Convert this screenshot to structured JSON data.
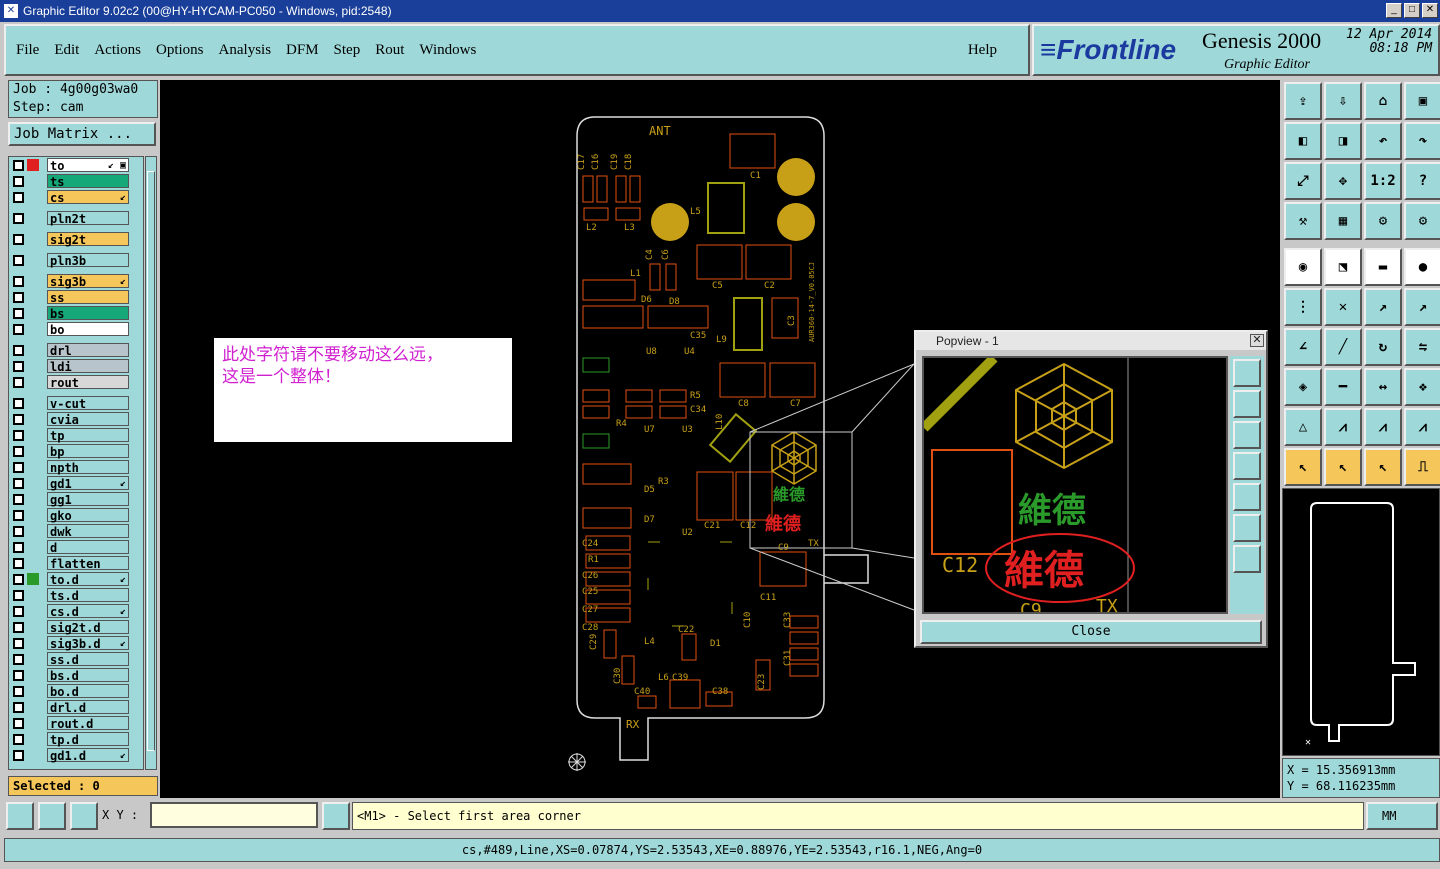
{
  "window": {
    "title": "Graphic Editor 9.02c2 (00@HY-HYCAM-PC050 - Windows, pid:2548)"
  },
  "menu": {
    "items": [
      "File",
      "Edit",
      "Actions",
      "Options",
      "Analysis",
      "DFM",
      "Step",
      "Rout",
      "Windows"
    ],
    "help": "Help"
  },
  "brand": {
    "logo": "≡Frontline",
    "product": "Genesis 2000",
    "subtitle": "Graphic Editor",
    "date": "12 Apr 2014",
    "time": "08:18 PM"
  },
  "job": {
    "job_line": "Job : 4g00g03wa0",
    "step_line": "Step: cam",
    "matrix_button": "Job Matrix ..."
  },
  "layers": [
    {
      "name": "to",
      "color": "#ffffff",
      "sw": "#e02020",
      "pen": "↙ ▣"
    },
    {
      "name": "ts",
      "color": "#16a878",
      "sw": "",
      "pen": ""
    },
    {
      "name": "cs",
      "color": "#f5c65a",
      "sw": "",
      "pen": "↙"
    },
    {
      "name": "pln2t",
      "color": "#9fd8d8",
      "sw": "",
      "pen": "",
      "gap": true
    },
    {
      "name": "sig2t",
      "color": "#f5c65a",
      "sw": "",
      "pen": "",
      "gap": true
    },
    {
      "name": "pln3b",
      "color": "#9fd8d8",
      "sw": "",
      "pen": "",
      "gap": true
    },
    {
      "name": "sig3b",
      "color": "#f5c65a",
      "sw": "",
      "pen": "↙",
      "gap": true
    },
    {
      "name": "ss",
      "color": "#f5c65a",
      "sw": "",
      "pen": ""
    },
    {
      "name": "bs",
      "color": "#16a878",
      "sw": "",
      "pen": ""
    },
    {
      "name": "bo",
      "color": "#ffffff",
      "sw": "",
      "pen": ""
    },
    {
      "name": "drl",
      "color": "#b8c4cc",
      "sw": "",
      "pen": "",
      "gap": true
    },
    {
      "name": "ldi",
      "color": "#b8c4cc",
      "sw": "",
      "pen": ""
    },
    {
      "name": "rout",
      "color": "#d8d8d8",
      "sw": "",
      "pen": ""
    },
    {
      "name": "v-cut",
      "color": "#9fd8d8",
      "sw": "",
      "pen": "",
      "gap": true
    },
    {
      "name": "cvia",
      "color": "#9fd8d8",
      "sw": "",
      "pen": ""
    },
    {
      "name": "tp",
      "color": "#9fd8d8",
      "sw": "",
      "pen": ""
    },
    {
      "name": "bp",
      "color": "#9fd8d8",
      "sw": "",
      "pen": ""
    },
    {
      "name": "npth",
      "color": "#9fd8d8",
      "sw": "",
      "pen": ""
    },
    {
      "name": "gd1",
      "color": "#9fd8d8",
      "sw": "",
      "pen": "↙"
    },
    {
      "name": "gg1",
      "color": "#9fd8d8",
      "sw": "",
      "pen": ""
    },
    {
      "name": "gko",
      "color": "#9fd8d8",
      "sw": "",
      "pen": ""
    },
    {
      "name": "dwk",
      "color": "#9fd8d8",
      "sw": "",
      "pen": ""
    },
    {
      "name": "d",
      "color": "#9fd8d8",
      "sw": "",
      "pen": ""
    },
    {
      "name": "flatten",
      "color": "#9fd8d8",
      "sw": "",
      "pen": ""
    },
    {
      "name": "to.d",
      "color": "#9fd8d8",
      "sw": "#2a9a2a",
      "pen": "↙"
    },
    {
      "name": "ts.d",
      "color": "#9fd8d8",
      "sw": "",
      "pen": ""
    },
    {
      "name": "cs.d",
      "color": "#9fd8d8",
      "sw": "",
      "pen": "↙"
    },
    {
      "name": "sig2t.d",
      "color": "#9fd8d8",
      "sw": "",
      "pen": ""
    },
    {
      "name": "sig3b.d",
      "color": "#9fd8d8",
      "sw": "",
      "pen": "↙"
    },
    {
      "name": "ss.d",
      "color": "#9fd8d8",
      "sw": "",
      "pen": ""
    },
    {
      "name": "bs.d",
      "color": "#9fd8d8",
      "sw": "",
      "pen": ""
    },
    {
      "name": "bo.d",
      "color": "#9fd8d8",
      "sw": "",
      "pen": ""
    },
    {
      "name": "drl.d",
      "color": "#9fd8d8",
      "sw": "",
      "pen": ""
    },
    {
      "name": "rout.d",
      "color": "#9fd8d8",
      "sw": "",
      "pen": ""
    },
    {
      "name": "tp.d",
      "color": "#9fd8d8",
      "sw": "",
      "pen": ""
    },
    {
      "name": "gd1.d",
      "color": "#9fd8d8",
      "sw": "",
      "pen": "↙"
    }
  ],
  "selected": "Selected : 0",
  "note": {
    "line1": "此处字符请不要移动这么远，",
    "line2": "这是一个整体！"
  },
  "popview": {
    "title": "Popview - 1",
    "close": "Close",
    "label_c12": "C12",
    "label_c9": "C9",
    "label_tx": "TX",
    "logo_text": "維德"
  },
  "board": {
    "ant": "ANT",
    "rx": "RX",
    "labels": [
      "C17",
      "C16",
      "C19",
      "C18",
      "C1",
      "L5",
      "L2",
      "L3",
      "C4",
      "C6",
      "L1",
      "C5",
      "C2",
      "D6",
      "D8",
      "C3",
      "L9",
      "C35",
      "U8",
      "U4",
      "R5",
      "C34",
      "C8",
      "C7",
      "R4",
      "U7",
      "U3",
      "L10",
      "R3",
      "D5",
      "D7",
      "C21",
      "C12",
      "U2",
      "TX",
      "C9",
      "C24",
      "R1",
      "C26",
      "C25",
      "C27",
      "C28",
      "C11",
      "C10",
      "C22",
      "D1",
      "L4",
      "C29",
      "C30",
      "C40",
      "C39",
      "L6",
      "C38",
      "C23",
      "C33",
      "C31"
    ],
    "side_text": "AUR360-14-7_V0.05CJ"
  },
  "coords": {
    "x": "X = 15.356913mm",
    "y": "Y = 68.116235mm"
  },
  "cmd": {
    "xy_label": "X Y :",
    "prompt": "<M1> - Select first area corner",
    "unit": "MM"
  },
  "status": "cs,#489,Line,XS=0.07874,YS=2.53543,XE=0.88976,YE=2.53543,r16.1,NEG,Ang=0",
  "icons": [
    "open-icon",
    "save-icon",
    "home-icon",
    "window-icon",
    "left-arrow-icon",
    "right-arrow-icon",
    "undo-icon",
    "redo-icon",
    "zoom-fit-icon",
    "zoom-move-icon",
    "one-to-one-icon",
    "help-icon",
    "measure-icon",
    "grid-icon",
    "layers-icon",
    "layers2-icon"
  ]
}
